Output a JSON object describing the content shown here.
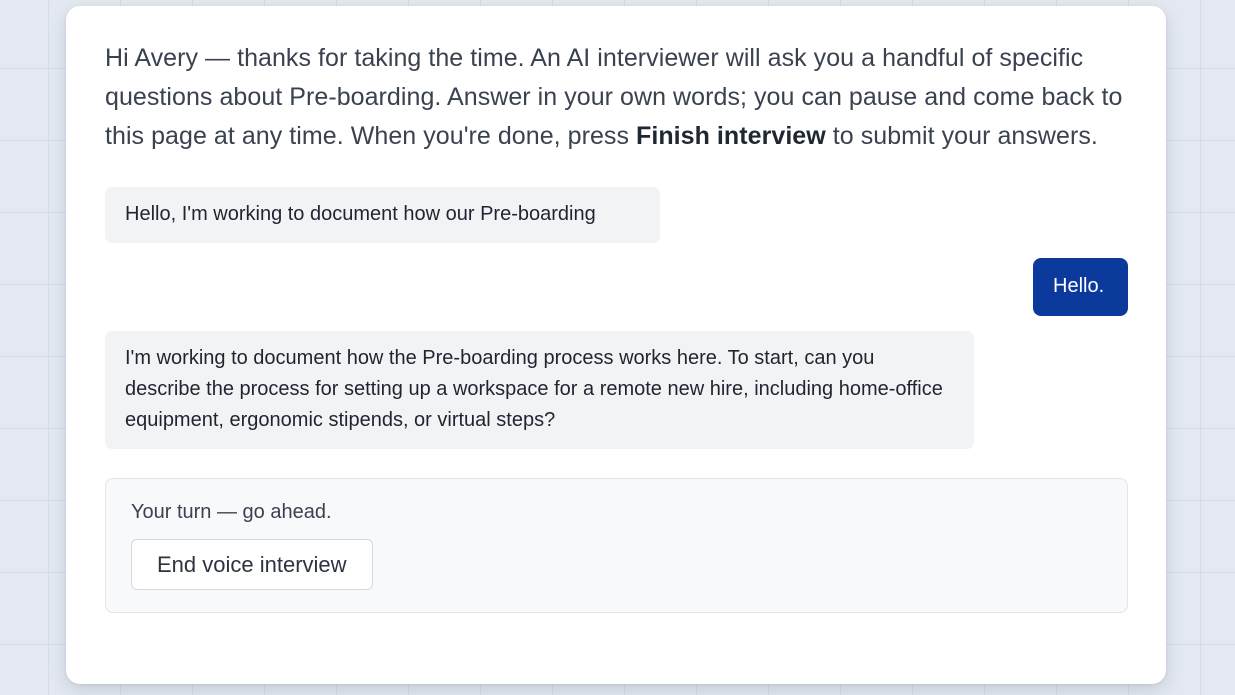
{
  "intro": {
    "before_bold": "Hi Avery — thanks for taking the time. An AI interviewer will ask you a handful of specific questions about Pre-boarding. Answer in your own words; you can pause and come back to this page at any time. When you're done, press ",
    "bold": "Finish interview",
    "after_bold": " to submit your answers."
  },
  "messages": [
    {
      "role": "interviewer",
      "text": "Hello, I'm working to document how our Pre-boarding"
    },
    {
      "role": "respondent",
      "text": "Hello."
    },
    {
      "role": "interviewer",
      "text": "I'm working to document how the Pre-boarding process works here. To start, can you describe the process for setting up a workspace for a remote new hire, including home-office equipment, ergonomic stipends, or virtual steps?"
    }
  ],
  "turn_panel": {
    "status": "Your turn — go ahead.",
    "end_button_label": "End voice interview"
  },
  "colors": {
    "user_bubble": "#0b3a9c",
    "bot_bubble": "#f2f3f5",
    "page_background": "#e4e9f1",
    "card_background": "#ffffff"
  }
}
